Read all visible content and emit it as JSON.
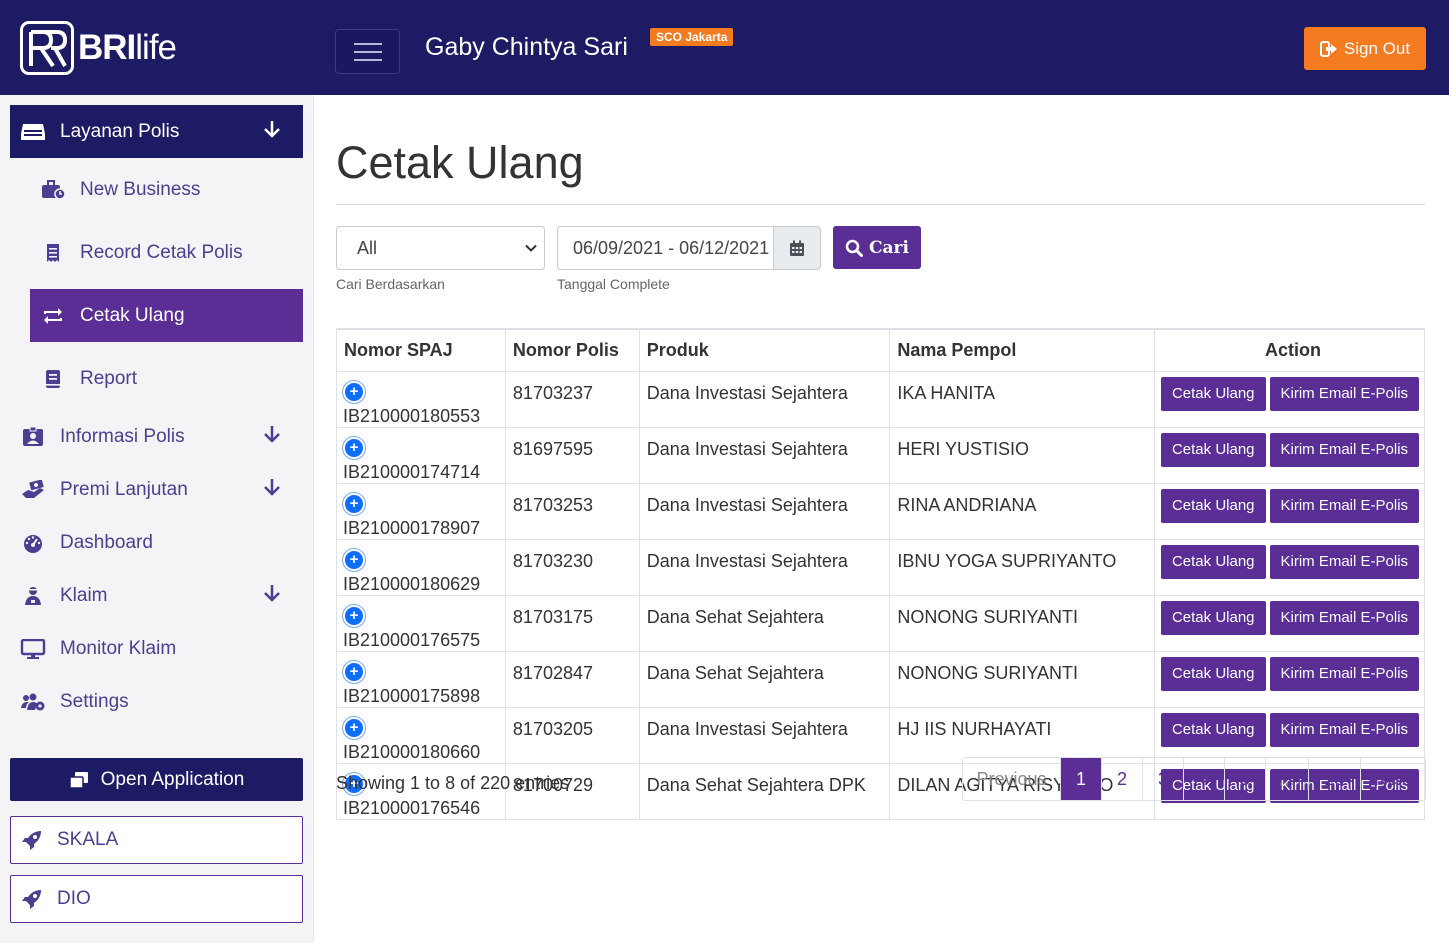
{
  "header": {
    "logo_bold": "BRI",
    "logo_light": "life",
    "user_name": "Gaby Chintya Sari",
    "branch_badge": "SCO Jakarta",
    "signout_label": "Sign Out"
  },
  "sidebar": {
    "layanan_polis": "Layanan Polis",
    "sub_items": {
      "new_business": "New Business",
      "record_cetak_polis": "Record Cetak Polis",
      "cetak_ulang": "Cetak Ulang",
      "report": "Report"
    },
    "items": {
      "informasi_polis": "Informasi Polis",
      "premi_lanjutan": "Premi Lanjutan",
      "dashboard": "Dashboard",
      "klaim": "Klaim",
      "monitor_klaim": "Monitor Klaim",
      "settings": "Settings"
    },
    "open_application": "Open Application",
    "skala": "SKALA",
    "dio": "DIO"
  },
  "main": {
    "title": "Cetak Ulang",
    "filter": {
      "select_value": "All",
      "select_hint": "Cari Berdasarkan",
      "date_value": "06/09/2021 - 06/12/2021",
      "date_hint": "Tanggal Complete",
      "search_label": "Cari"
    },
    "table": {
      "headers": {
        "nomor_spaj": "Nomor SPAJ",
        "nomor_polis": "Nomor Polis",
        "produk": "Produk",
        "nama_pempol": "Nama Pempol",
        "action": "Action"
      },
      "action_labels": {
        "cetak_ulang": "Cetak Ulang",
        "kirim_email": "Kirim Email E-Polis"
      },
      "rows": [
        {
          "spaj": "IB210000180553",
          "polis": "81703237",
          "produk": "Dana Investasi Sejahtera",
          "nama": "IKA HANITA"
        },
        {
          "spaj": "IB210000174714",
          "polis": "81697595",
          "produk": "Dana Investasi Sejahtera",
          "nama": "HERI YUSTISIO"
        },
        {
          "spaj": "IB210000178907",
          "polis": "81703253",
          "produk": "Dana Investasi Sejahtera",
          "nama": "RINA ANDRIANA"
        },
        {
          "spaj": "IB210000180629",
          "polis": "81703230",
          "produk": "Dana Investasi Sejahtera",
          "nama": "IBNU YOGA SUPRIYANTO"
        },
        {
          "spaj": "IB210000176575",
          "polis": "81703175",
          "produk": "Dana Sehat Sejahtera",
          "nama": "NONONG SURIYANTI"
        },
        {
          "spaj": "IB210000175898",
          "polis": "81702847",
          "produk": "Dana Sehat Sejahtera",
          "nama": "NONONG SURIYANTI"
        },
        {
          "spaj": "IB210000180660",
          "polis": "81703205",
          "produk": "Dana Investasi Sejahtera",
          "nama": "HJ IIS NURHAYATI"
        },
        {
          "spaj": "IB210000176546",
          "polis": "81700729",
          "produk": "Dana Sehat Sejahtera DPK",
          "nama": "DILAN AGITYA RISYANTO"
        }
      ]
    },
    "showing": "Showing 1 to 8 of 220 entries",
    "pagination": {
      "previous": "Previous",
      "pages": [
        "1",
        "2",
        "3",
        "4",
        "5",
        "…",
        "28"
      ],
      "current": "1",
      "next": "Next"
    }
  },
  "colors": {
    "navy": "#1d1b64",
    "purple": "#5a2e94",
    "orange": "#f47b20",
    "link": "#4c3f91"
  },
  "icons": {
    "layanan_polis": "hdd-icon",
    "new_business": "briefcase-clock-icon",
    "record_cetak_polis": "receipt-icon",
    "cetak_ulang": "retweet-icon",
    "report": "book-icon",
    "informasi_polis": "id-badge-icon",
    "premi_lanjutan": "money-hand-icon",
    "dashboard": "gauge-icon",
    "klaim": "user-injured-icon",
    "monitor_klaim": "desktop-icon",
    "settings": "users-cog-icon",
    "open_application": "window-restore-icon",
    "skala": "rocket-icon",
    "dio": "rocket-icon"
  }
}
